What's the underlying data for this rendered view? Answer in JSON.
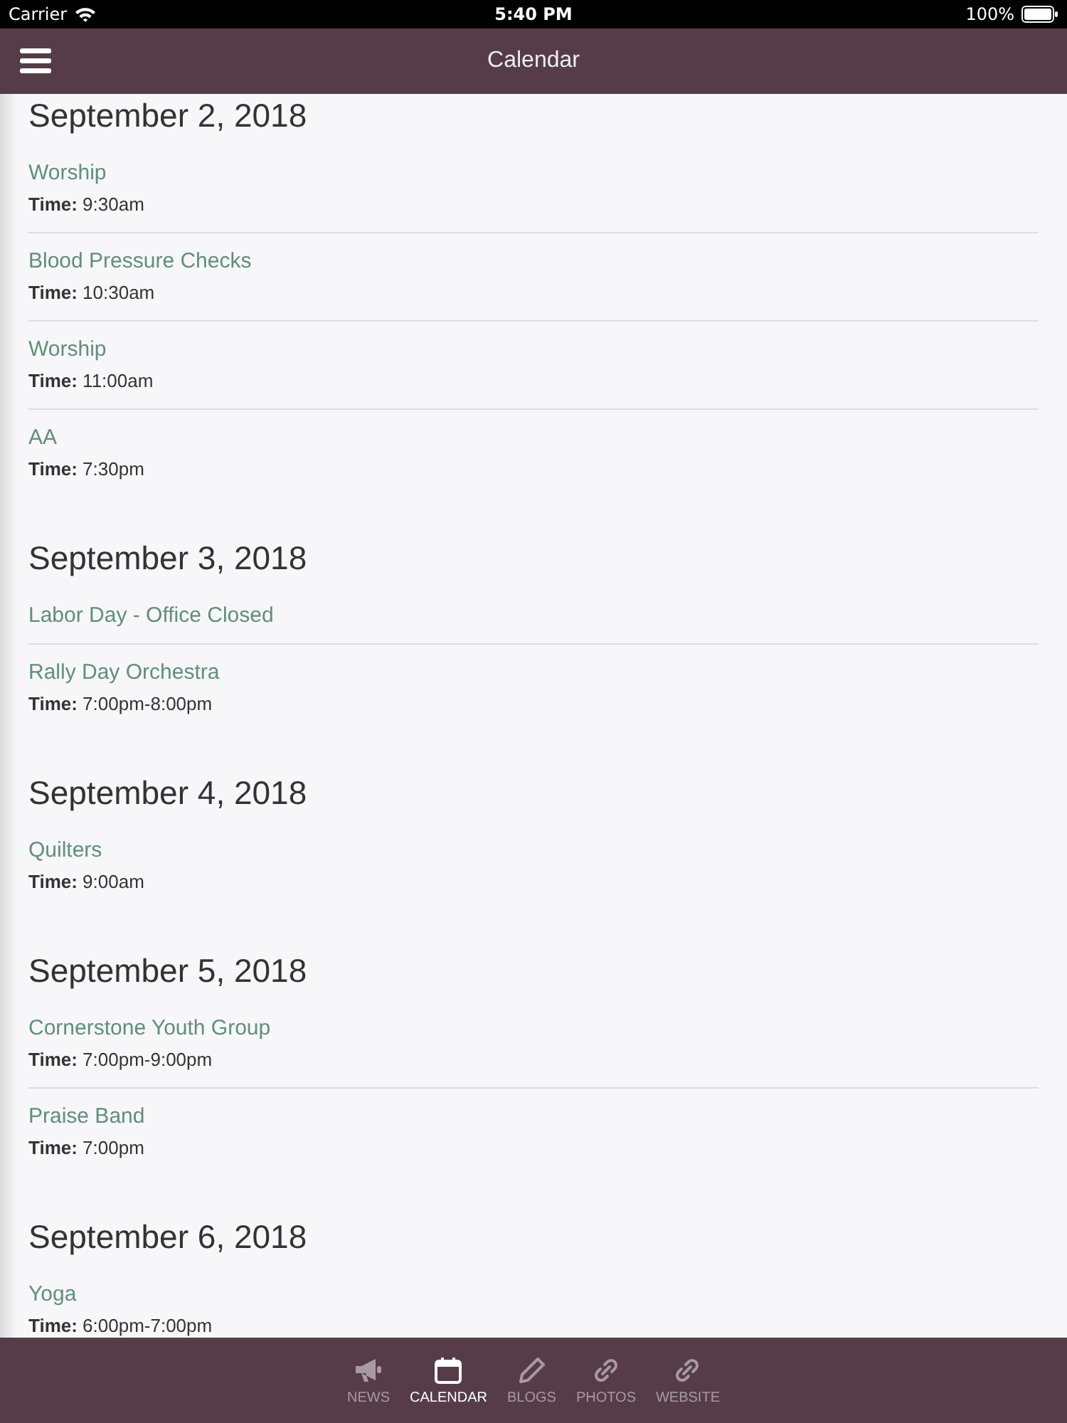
{
  "status_bar": {
    "carrier": "Carrier",
    "time": "5:40 PM",
    "battery": "100%"
  },
  "nav_bar": {
    "title": "Calendar"
  },
  "days": [
    {
      "date": "September 2, 2018",
      "events": [
        {
          "title": "Worship",
          "time": "**Time:** 9:30am"
        },
        {
          "title": "Blood Pressure Checks",
          "time": "**Time:** 10:30am"
        },
        {
          "title": "Worship",
          "time": "**Time:** 11:00am"
        },
        {
          "title": "AA",
          "time": "**Time:** 7:30pm"
        }
      ]
    },
    {
      "date": "September 3, 2018",
      "events": [
        {
          "title": "Labor Day - Office Closed"
        },
        {
          "title": "Rally Day Orchestra",
          "time": "**Time:** 7:00pm-8:00pm"
        }
      ]
    },
    {
      "date": "September 4, 2018",
      "events": [
        {
          "title": "Quilters",
          "time": "**Time:** 9:00am"
        }
      ]
    },
    {
      "date": "September 5, 2018",
      "events": [
        {
          "title": "Cornerstone Youth Group",
          "time": "**Time:** 7:00pm-9:00pm"
        },
        {
          "title": "Praise Band",
          "time": "**Time:** 7:00pm"
        }
      ]
    },
    {
      "date": "September 6, 2018",
      "events": [
        {
          "title": "Yoga",
          "time": "**Time:** 6:00pm-7:00pm"
        }
      ]
    }
  ],
  "tab_bar": [
    {
      "label": "NEWS",
      "kind": "megaphone",
      "selected": false
    },
    {
      "label": "CALENDAR",
      "kind": "calendar",
      "selected": true
    },
    {
      "label": "BLOGS",
      "kind": "pencil",
      "selected": false
    },
    {
      "label": "PHOTOS",
      "kind": "link",
      "selected": false
    },
    {
      "label": "WEBSITE",
      "kind": "link",
      "selected": false
    }
  ]
}
